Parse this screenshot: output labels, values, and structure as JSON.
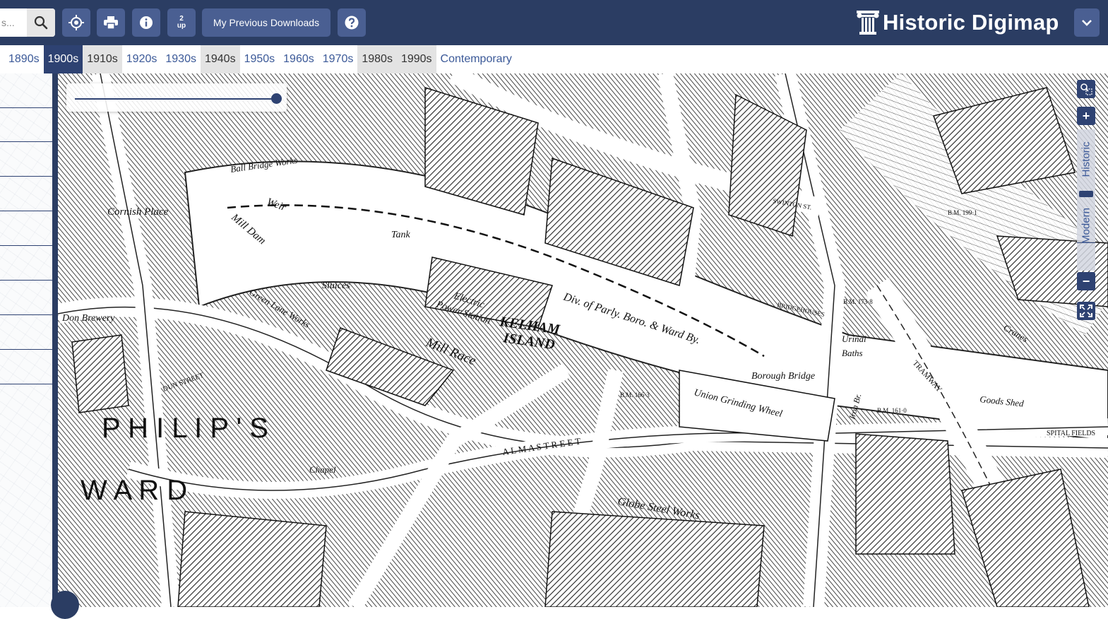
{
  "header": {
    "search": {
      "value": "s...",
      "placeholder": "Search"
    },
    "downloads_label": "My Previous Downloads",
    "twoup_top": "2",
    "twoup_bottom": "up",
    "brand_title": "Historic Digimap",
    "colors": {
      "header_bg": "#2b3d63",
      "button_bg": "#4a5f92",
      "active": "#2e4272"
    },
    "icons": [
      "search-icon",
      "locate-icon",
      "print-icon",
      "info-icon",
      "two-up-icon",
      "help-icon",
      "pillar-logo-icon",
      "chevron-down-icon"
    ]
  },
  "decades": [
    {
      "label": "1890s",
      "state": "normal"
    },
    {
      "label": "1900s",
      "state": "active"
    },
    {
      "label": "1910s",
      "state": "grey"
    },
    {
      "label": "1920s",
      "state": "normal"
    },
    {
      "label": "1930s",
      "state": "normal"
    },
    {
      "label": "1940s",
      "state": "grey"
    },
    {
      "label": "1950s",
      "state": "normal"
    },
    {
      "label": "1960s",
      "state": "normal"
    },
    {
      "label": "1970s",
      "state": "normal"
    },
    {
      "label": "1980s",
      "state": "grey"
    },
    {
      "label": "1990s",
      "state": "grey"
    },
    {
      "label": "Contemporary",
      "state": "normal"
    }
  ],
  "opacity_slider": {
    "value": 1.0
  },
  "zoom": {
    "historic_label": "Historic",
    "modern_label": "Modern",
    "plus": "+",
    "minus": "−"
  },
  "map": {
    "labels": {
      "kelham": "KELHAM",
      "island": "ISLAND",
      "philips": "P H I L I P ' S",
      "ward": "W A R D",
      "mill_race": "Mill Race",
      "mill_dam": "Mill Dam",
      "weir": "Weir",
      "sluices": "Sluices",
      "tank": "Tank",
      "electric": "Electric",
      "power_station": "Power Station",
      "division": "Div. of Parly. Boro. & Ward By.",
      "borough_bridge": "Borough Bridge",
      "union_grinding_wheel": "Union Grinding Wheel",
      "globe_steel_works": "Globe Steel Works",
      "globe_steel_works_2": "Steel Works",
      "green_lane_works": "Green Lane Works",
      "cornish_place": "Cornish Place",
      "don_brewery": "Don Brewery",
      "ball_bridge_works": "Ball Bridge Works",
      "alma_street": "A L M A   S T R E E T",
      "dun_street": "DUN STREET",
      "bridgehouses": "BRIDGEHOUSES",
      "swinton_st": "SWINTON ST.",
      "cranes": "Cranes",
      "goods_shed": "Goods Shed",
      "tramway": "TRAMWAY",
      "spital_fields": "SPITAL FIELDS",
      "chapel": "Chapel",
      "urinal": "Urinal",
      "baths": "Baths",
      "iron_br": "Iron Br.",
      "bm_166": "B.M. 166·3",
      "bm_161": "B.M. 161·0",
      "bm_173": "B.M. 173·8",
      "bm_199": "B.M. 199·1"
    }
  }
}
